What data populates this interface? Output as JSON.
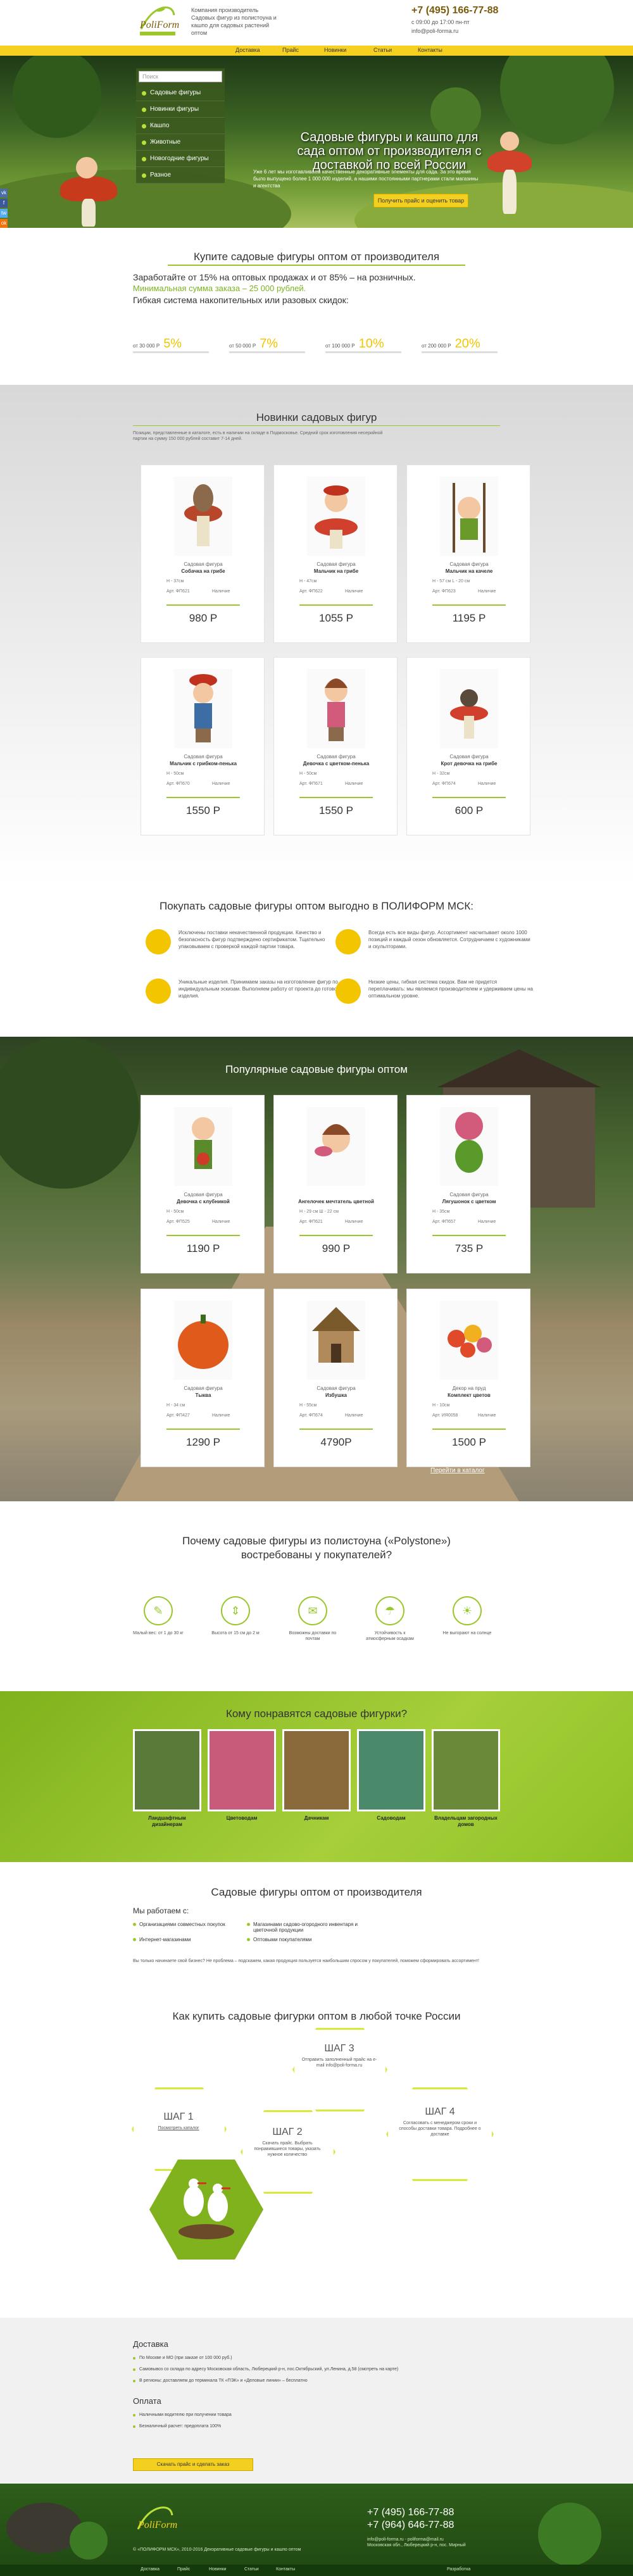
{
  "header": {
    "logo": "PoliForm",
    "about": "Компания производитель Садовых фигур из полистоуна и кашпо для садовых растений оптом",
    "phone": "+7 (495) 166-77-88",
    "hours": "с 09:00 до 17:00 пн-пт",
    "email": "info@poli-forma.ru",
    "nav": [
      "Доставка",
      "Прайс",
      "Новинки",
      "Статьи",
      "Контакты"
    ]
  },
  "hero": {
    "search_placeholder": "Поиск",
    "categories": [
      "Садовые фигуры",
      "Новинки фигуры",
      "Кашпо",
      "Животные",
      "Новогодние фигуры",
      "Разное"
    ],
    "title": "Садовые фигуры и кашпо для сада оптом от производителя с доставкой по всей России",
    "lead": "Уже 6 лет мы изготавливаем качественные декоративные элементы для сада. За это время было выпущено более 1 000 000 изделий, а нашими постоянными партнерами стали магазины и агентства",
    "cta": "Получить прайс и оценить товар",
    "social": [
      "vk",
      "f",
      "tw",
      "ok",
      "g+",
      "in"
    ]
  },
  "wholesale": {
    "title": "Купите садовые фигуры оптом от производителя",
    "line1": "Заработайте от 15% на оптовых продажах и от 85% – на розничных.",
    "line2": "Минимальная сумма заказа – 25 000 рублей.",
    "line3": "Гибкая система накопительных или разовых скидок:",
    "tiers": [
      {
        "from": "от 30 000 Р",
        "pct": "5%"
      },
      {
        "from": "от 50 000 Р",
        "pct": "7%"
      },
      {
        "from": "от 100 000 Р",
        "pct": "10%"
      },
      {
        "from": "от 200 000 Р",
        "pct": "20%"
      }
    ]
  },
  "newfigures": {
    "title": "Новинки садовых фигур",
    "note": "Позиции, представленные в каталоге, есть в наличии на складе в Подмосковье. Средний срок изготовления несерийной партии на сумму 150 000 рублей составит 7-14 дней.",
    "cards": [
      {
        "type": "Садовая фигура",
        "name": "Собачка на грибе",
        "dims": "Н - 37см",
        "art": "Арт. ФП621",
        "avail": "Наличие",
        "price": "980 Р"
      },
      {
        "type": "Садовая фигура",
        "name": "Мальчик на грибе",
        "dims": "Н - 47см",
        "art": "Арт. ФП622",
        "avail": "Наличие",
        "price": "1055 Р"
      },
      {
        "type": "Садовая фигура",
        "name": "Мальчик на качеле",
        "dims": "Н - 57 см   L - 20 см",
        "art": "Арт. ФП623",
        "avail": "Наличие",
        "price": "1195 Р"
      },
      {
        "type": "Садовая фигура",
        "name": "Мальчик с грибком-пенька",
        "dims": "Н - 50см",
        "art": "Арт. ФП670",
        "avail": "Наличие",
        "price": "1550 Р"
      },
      {
        "type": "Садовая фигура",
        "name": "Девочка с цветком-пенька",
        "dims": "Н - 50см",
        "art": "Арт. ФП671",
        "avail": "Наличие",
        "price": "1550 Р"
      },
      {
        "type": "Садовая фигура",
        "name": "Крот девочка на грибе",
        "dims": "Н - 32см",
        "art": "Арт. ФП674",
        "avail": "Наличие",
        "price": "600 Р"
      }
    ]
  },
  "benefits": {
    "title": "Покупать садовые фигуры оптом выгодно в ПОЛИФОРМ МСК:",
    "items": [
      "Исключены поставки некачественной продукции. Качество и безопасность фигур подтверждено сертификатом. Тщательно упаковываем с проверкой каждой партии товара.",
      "Всегда есть все виды фигур. Ассортимент насчитывает около 1000 позиций и каждый сезон обновляется. Сотрудничаем с художниками и скульпторами.",
      "Уникальные изделия. Принимаем заказы на изготовление фигур по индивидуальным эскизам. Выполняем работу от проекта до готового изделия.",
      "Низкие цены, гибкая система скидок. Вам не придется переплачивать: мы являемся производителем и удерживаем цены на оптимальном уровне."
    ]
  },
  "popular": {
    "title": "Популярные садовые фигуры оптом",
    "more": "Перейти в каталог",
    "cards": [
      {
        "type": "Садовая фигура",
        "name": "Девочка с клубникой",
        "dims": "Н - 50см",
        "art": "Арт. ФП525",
        "avail": "Наличие",
        "price": "1190 Р"
      },
      {
        "type": "",
        "name": "Ангелочек мечтатель цветной",
        "dims": "Н - 29 см   Ш - 22 см",
        "art": "Арт. ФП621",
        "avail": "Наличие",
        "price": "990 Р"
      },
      {
        "type": "Садовая фигура",
        "name": "Лягушонок с цветком",
        "dims": "Н - 35см",
        "art": "Арт. ФП657",
        "avail": "Наличие",
        "price": "735 Р"
      },
      {
        "type": "Садовая фигура",
        "name": "Тыква",
        "dims": "Н - 34 см",
        "art": "Арт. ФП427",
        "avail": "Наличие",
        "price": "1290 Р"
      },
      {
        "type": "Садовая фигура",
        "name": "Избушка",
        "dims": "Н - 55см",
        "art": "Арт. ФП674",
        "avail": "Наличие",
        "price": "4790Р"
      },
      {
        "type": "Декор на пруд",
        "name": "Комплект цветов",
        "dims": "Н - 10см",
        "art": "Арт. ИЯ0058",
        "avail": "Наличие",
        "price": "1500 Р"
      }
    ]
  },
  "why": {
    "title": "Почему садовые фигуры из полистоуна («Polystone») востребованы у покупателей?",
    "items": [
      "Малый вес: от 1 до 30 кг",
      "Высота от 15 см до 2 м",
      "Возможны доставки по почтам",
      "Устойчивость к атмосферным осадкам",
      "Не выгорают на солнце"
    ]
  },
  "who": {
    "title": "Кому понравятся садовые фигурки?",
    "items": [
      "Ландшафтным дизайнерам",
      "Цветоводам",
      "Дачникам",
      "Садоводам",
      "Владельцам загородных домов"
    ]
  },
  "about": {
    "title": "Садовые фигуры оптом от производителя",
    "workwith": "Мы работаем с:",
    "list": [
      "Организациями совместных покупок",
      "Магазинами садово-огородного инвентаря и цветочной продукции",
      "Интернет-магазинами",
      "Оптовыми покупателями"
    ],
    "note": "Вы только начинаете свой бизнес? Не проблема – подскажем, какая продукция пользуется наибольшим спросом у покупателей, поможем сформировать ассортимент!",
    "how_title": "Как купить садовые фигурки оптом в любой точке России",
    "steps": [
      {
        "label": "ШАГ 1",
        "text": "Посмотреть каталог"
      },
      {
        "label": "ШАГ 2",
        "text": "Скачать прайс. Выбрать понравившиеся товары, указать нужное количество"
      },
      {
        "label": "ШАГ 3",
        "text": "Отправить заполненный прайс на e-mail info@poli-forma.ru"
      },
      {
        "label": "ШАГ 4",
        "text": "Согласовать с менеджером сроки и способы доставки товара. Подробнее о доставке"
      }
    ]
  },
  "delivery": {
    "title": "Доставка",
    "items": [
      "По Москве и МО (при заказе от 100 000 руб.)",
      "Самовывоз со склада по адресу Московская область, Люберецкий р-н, пос.Октябрьский, ул.Ленина, д.58 (смотреть на карте)",
      "В регионы: доставляем до терминала ТК «ПЭК» и «Деловые линии» – бесплатно"
    ],
    "pay_title": "Оплата",
    "pay": [
      "Наличными водителю при получении товара",
      "Безналичный расчет: предоплата 100%"
    ],
    "btn": "Скачать прайс и сделать заказ"
  },
  "footer": {
    "logo": "PoliForm",
    "copyright": "© «ПОЛИФОРМ МСК», 2010-2016 Декоративные садовые фигуры и кашпо оптом",
    "phone1": "+7 (495) 166-77-88",
    "phone2": "+7 (964) 646-77-88",
    "email": "info@poli-forma.ru - poliforma@mail.ru",
    "address": "Московская обл., Люберецкий р-н, пос. Мирный",
    "nav": [
      "Доставка",
      "Прайс",
      "Новинки",
      "Статьи",
      "Контакты"
    ],
    "dev": "Разработка"
  },
  "colors": {
    "accent": "#9ac72a",
    "yellow": "#f3d020",
    "dark_green": "#2e5e1a"
  }
}
